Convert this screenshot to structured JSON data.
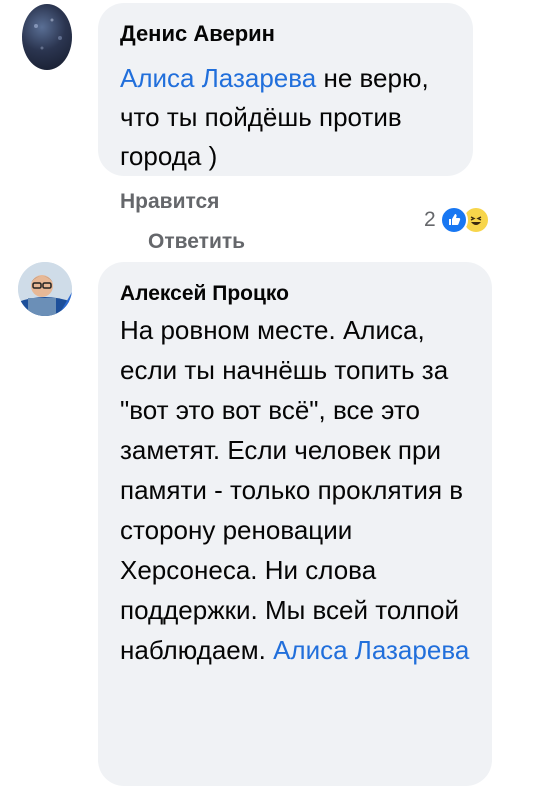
{
  "comments": [
    {
      "author": "Денис Аверин",
      "mention": "Алиса Лазарева",
      "text": " не верю, что ты пойдёшь против города )",
      "actions": {
        "like": "Нравится",
        "reply": "Ответить"
      },
      "reactions": {
        "count": "2",
        "icons": [
          "like-icon",
          "haha-icon"
        ]
      }
    },
    {
      "author": "Алексей Процко",
      "text": "На ровном месте. Алиса, если ты начнёшь топить за \"вот это вот всё\", все это заметят. Если человек при памяти - только проклятия в сторону реновации Херсонеса. Ни слова поддержки. Мы всей толпой наблюдаем. ",
      "mention": "Алиса Лазарева"
    }
  ],
  "colors": {
    "mention": "#216fdb",
    "bubble": "#f0f2f5",
    "meta": "#65676b",
    "like": "#1877f2"
  }
}
